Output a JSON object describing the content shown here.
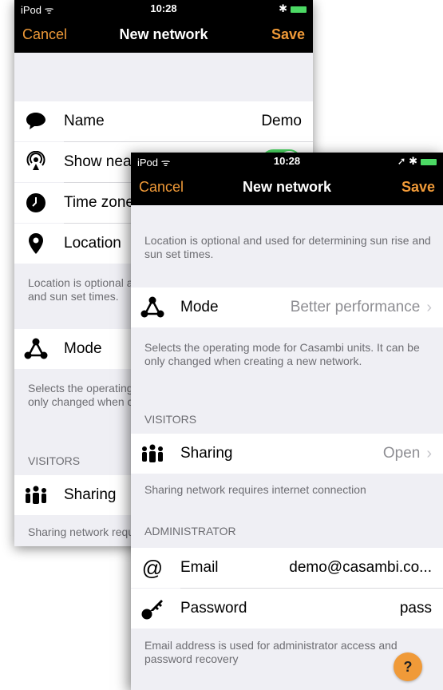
{
  "colors": {
    "accent": "#f09a38",
    "toggle_on": "#4cd964",
    "background": "#efeff4"
  },
  "back_screen": {
    "status": {
      "carrier": "iPod ᯤ",
      "time": "10:28",
      "right": "✱"
    },
    "nav": {
      "cancel": "Cancel",
      "title": "New network",
      "save": "Save"
    },
    "rows": [
      {
        "icon": "speech-bubble-icon",
        "label": "Name",
        "value": "Demo"
      },
      {
        "icon": "broadcast-icon",
        "label": "Show nea",
        "toggle_on": true
      },
      {
        "icon": "clock-icon",
        "label": "Time zone"
      },
      {
        "icon": "location-pin-icon",
        "label": "Location"
      }
    ],
    "location_note": "Location is optional and used for determining sun rise and sun set times.",
    "mode_row": {
      "icon": "mode-triangle-icon",
      "label": "Mode"
    },
    "mode_note": "Selects the operating mode for Casambi units. It can be only changed when creating a new network.",
    "visitors_header": "VISITORS",
    "sharing_row": {
      "icon": "people-icon",
      "label": "Sharing"
    },
    "sharing_note": "Sharing network requires internet connection"
  },
  "front_screen": {
    "status": {
      "carrier": "iPod ᯤ",
      "time": "10:28",
      "right": "➚ ✱"
    },
    "nav": {
      "cancel": "Cancel",
      "title": "New network",
      "save": "Save"
    },
    "location_note": "Location is optional and used for determining sun rise and sun set times.",
    "mode_row": {
      "icon": "mode-triangle-icon",
      "label": "Mode",
      "value": "Better performance"
    },
    "mode_note": "Selects the operating mode for Casambi units. It can be only changed when creating a new network.",
    "visitors_header": "VISITORS",
    "sharing_row": {
      "icon": "people-icon",
      "label": "Sharing",
      "value": "Open"
    },
    "sharing_note": "Sharing network requires internet connection",
    "admin_header": "ADMINISTRATOR",
    "email_row": {
      "icon": "at-sign-icon",
      "label": "Email",
      "value": "demo@casambi.co..."
    },
    "password_row": {
      "icon": "key-icon",
      "label": "Password",
      "value": "pass"
    },
    "email_note": "Email address is used for administrator access and password recovery",
    "help_label": "?"
  }
}
